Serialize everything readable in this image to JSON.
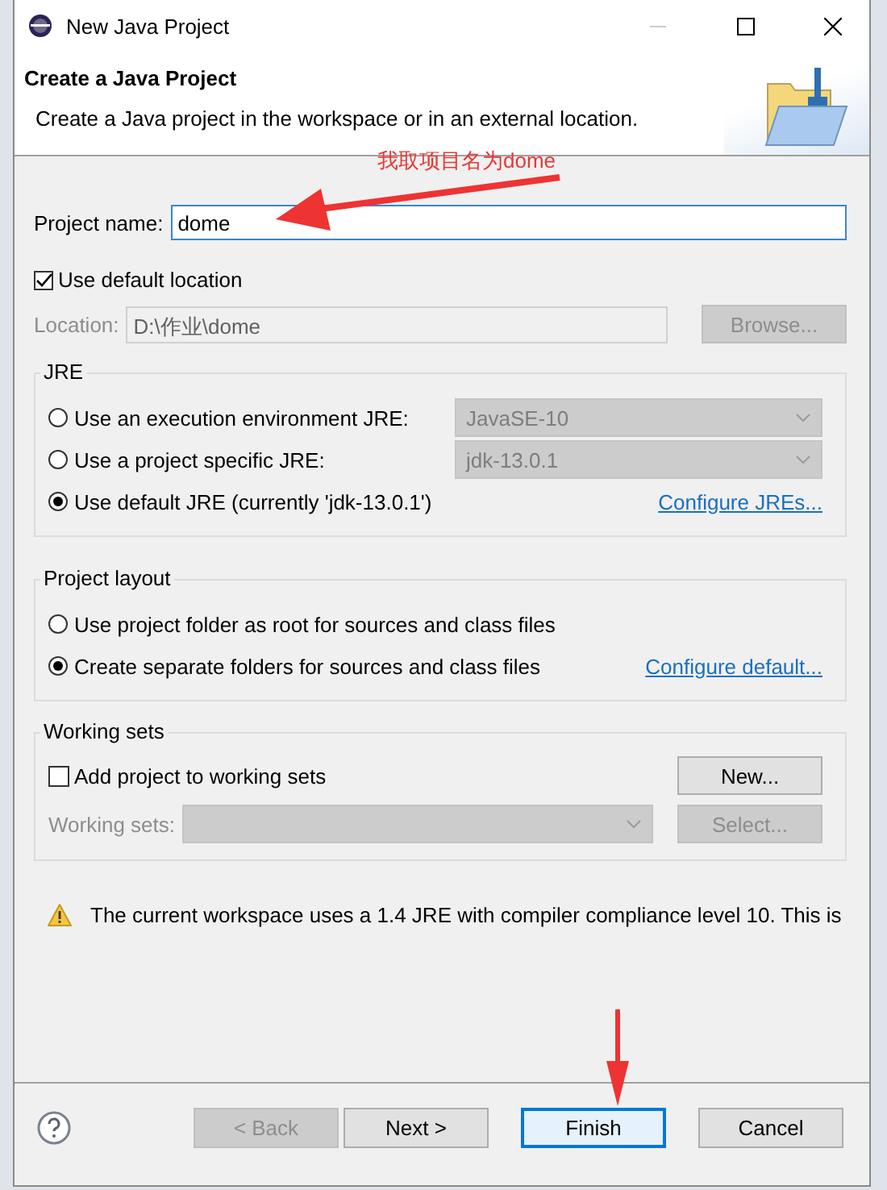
{
  "window": {
    "title": "New Java Project"
  },
  "header": {
    "title": "Create a Java Project",
    "description": "Create a Java project in the workspace or in an external location."
  },
  "annotations": [
    {
      "text": "我取项目名为dome"
    }
  ],
  "project_name": {
    "label": "Project name:",
    "value": "dome"
  },
  "default_location": {
    "label": "Use default location",
    "checked": true
  },
  "location": {
    "label": "Location:",
    "value": "D:\\作业\\dome",
    "disabled": true,
    "button": "Browse..."
  },
  "jre": {
    "title": "JRE",
    "options": [
      {
        "label": "Use an execution environment JRE:",
        "selected": false,
        "kind": "dropdown",
        "value": "JavaSE-10"
      },
      {
        "label": "Use a project specific JRE:",
        "selected": false,
        "kind": "dropdown",
        "value": "jdk-13.0.1"
      },
      {
        "label": "Use default JRE (currently 'jdk-13.0.1')",
        "selected": true,
        "kind": "link",
        "link": "Configure JREs..."
      }
    ]
  },
  "project_layout": {
    "title": "Project layout",
    "options": [
      {
        "label": "Use project folder as root for sources and class files",
        "selected": false,
        "kind": "plain"
      },
      {
        "label": "Create separate folders for sources and class files",
        "selected": true,
        "kind": "link",
        "link": "Configure default..."
      }
    ]
  },
  "working_sets": {
    "title": "Working sets",
    "add": {
      "label": "Add project to working sets",
      "checked": false
    },
    "new_button": "New...",
    "field_label": "Working sets:",
    "disabled": true,
    "select_button": "Select..."
  },
  "warning": "The current workspace uses a 1.4 JRE with compiler compliance level 10. This is",
  "buttons": [
    {
      "label": "< Back",
      "disabled": true,
      "default": false
    },
    {
      "label": "Next >",
      "disabled": false,
      "default": false
    },
    {
      "label": "Finish",
      "disabled": false,
      "default": true
    },
    {
      "label": "Cancel",
      "disabled": false,
      "default": false
    }
  ]
}
